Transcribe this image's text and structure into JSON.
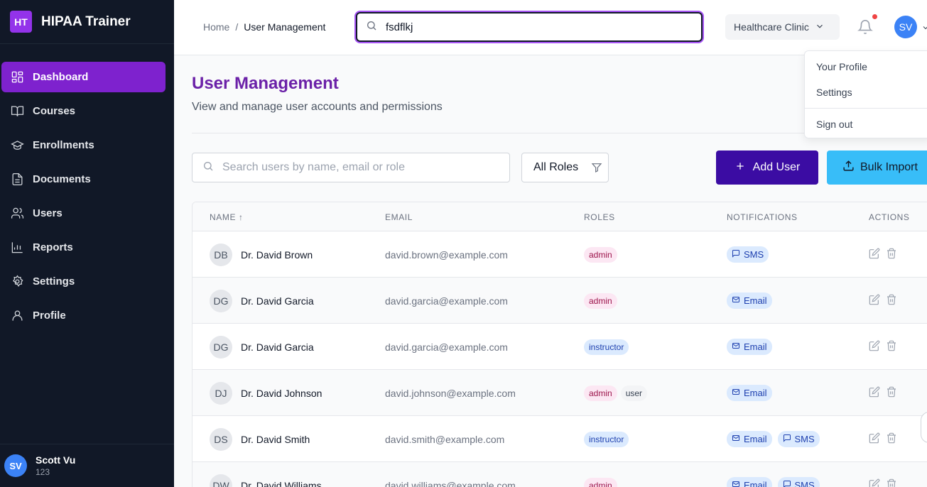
{
  "brand": {
    "logo": "HT",
    "name": "HIPAA Trainer"
  },
  "sidebar": {
    "items": [
      {
        "label": "Dashboard",
        "icon": "dashboard-icon"
      },
      {
        "label": "Courses",
        "icon": "book-icon"
      },
      {
        "label": "Enrollments",
        "icon": "graduation-cap-icon"
      },
      {
        "label": "Documents",
        "icon": "document-icon"
      },
      {
        "label": "Users",
        "icon": "users-icon"
      },
      {
        "label": "Reports",
        "icon": "bar-chart-icon"
      },
      {
        "label": "Settings",
        "icon": "gear-icon"
      },
      {
        "label": "Profile",
        "icon": "user-icon"
      }
    ],
    "active": "Dashboard",
    "user": {
      "initials": "SV",
      "name": "Scott Vu",
      "sub": "123"
    }
  },
  "header": {
    "breadcrumb": {
      "home": "Home",
      "sep": "/",
      "current": "User Management"
    },
    "search_value": "fsdflkj",
    "org": "Healthcare Clinic",
    "avatar": "SV"
  },
  "dropdown": {
    "items": [
      "Your Profile",
      "Settings",
      "Sign out"
    ]
  },
  "page": {
    "title": "User Management",
    "subtitle": "View and manage user accounts and permissions",
    "search_placeholder": "Search users by name, email or role",
    "role_filter": "All Roles",
    "add_user": "Add User",
    "bulk_import": "Bulk Import"
  },
  "table": {
    "headers": {
      "name": "NAME ↑",
      "email": "EMAIL",
      "roles": "ROLES",
      "notifications": "NOTIFICATIONS",
      "actions": "ACTIONS"
    },
    "rows": [
      {
        "initials": "DB",
        "name": "Dr. David Brown",
        "email": "david.brown@example.com",
        "roles": [
          "admin"
        ],
        "notifications": [
          "SMS"
        ]
      },
      {
        "initials": "DG",
        "name": "Dr. David Garcia",
        "email": "david.garcia@example.com",
        "roles": [
          "admin"
        ],
        "notifications": [
          "Email"
        ]
      },
      {
        "initials": "DG",
        "name": "Dr. David Garcia",
        "email": "david.garcia@example.com",
        "roles": [
          "instructor"
        ],
        "notifications": [
          "Email"
        ]
      },
      {
        "initials": "DJ",
        "name": "Dr. David Johnson",
        "email": "david.johnson@example.com",
        "roles": [
          "admin",
          "user"
        ],
        "notifications": [
          "Email"
        ]
      },
      {
        "initials": "DS",
        "name": "Dr. David Smith",
        "email": "david.smith@example.com",
        "roles": [
          "instructor"
        ],
        "notifications": [
          "Email",
          "SMS"
        ]
      },
      {
        "initials": "DW",
        "name": "Dr. David Williams",
        "email": "david.williams@example.com",
        "roles": [
          "admin"
        ],
        "notifications": [
          "Email",
          "SMS"
        ]
      }
    ]
  },
  "colors": {
    "sidebar_bg": "#111827",
    "active_nav": "#7e22ce",
    "title": "#6b21a8",
    "add_btn": "#3b0ca3",
    "import_btn": "#38bdf8"
  }
}
